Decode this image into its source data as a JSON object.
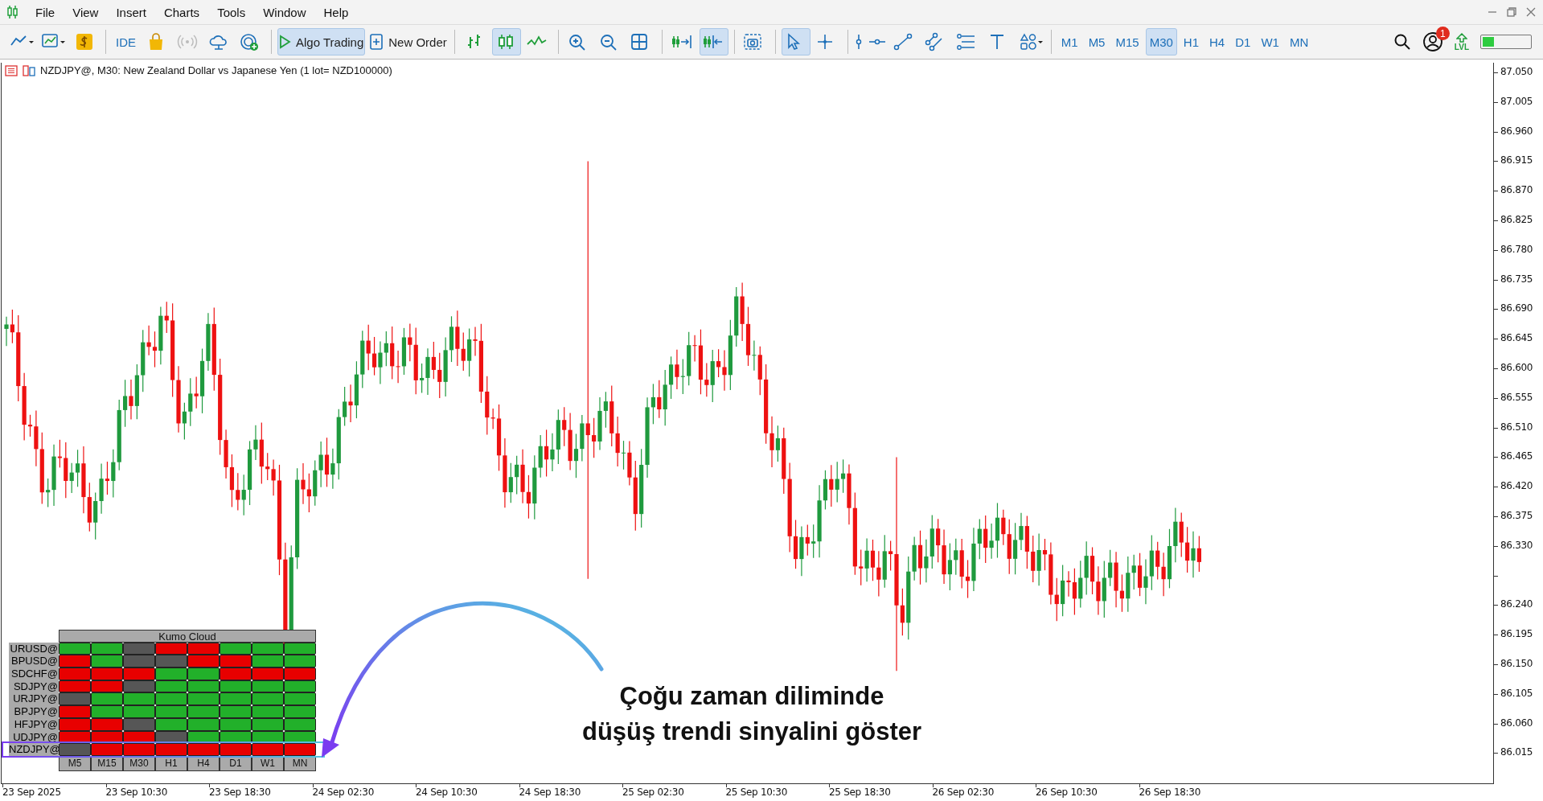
{
  "menu": {
    "items": [
      "File",
      "View",
      "Insert",
      "Charts",
      "Tools",
      "Window",
      "Help"
    ]
  },
  "toolbar": {
    "items": [
      {
        "kind": "line-chart",
        "selected": false
      },
      {
        "kind": "chart-menu",
        "selected": false
      },
      {
        "kind": "dollar",
        "selected": false
      },
      {
        "kind": "sep"
      },
      {
        "kind": "text",
        "label": "IDE",
        "selected": false
      },
      {
        "kind": "bag",
        "selected": false
      },
      {
        "kind": "signal",
        "selected": false
      },
      {
        "kind": "cloud",
        "selected": false
      },
      {
        "kind": "radar",
        "selected": false
      },
      {
        "kind": "sep"
      },
      {
        "kind": "play",
        "label": "Algo Trading",
        "selected": true
      },
      {
        "kind": "order",
        "label": "New Order",
        "selected": false
      },
      {
        "kind": "sep"
      },
      {
        "kind": "bars",
        "selected": false
      },
      {
        "kind": "candles",
        "selected": true
      },
      {
        "kind": "zigzag",
        "selected": false
      },
      {
        "kind": "sep"
      },
      {
        "kind": "zoom-in",
        "selected": false
      },
      {
        "kind": "zoom-out",
        "selected": false
      },
      {
        "kind": "grid",
        "selected": false
      },
      {
        "kind": "sep"
      },
      {
        "kind": "shift",
        "selected": false
      },
      {
        "kind": "autoscroll",
        "selected": true
      },
      {
        "kind": "sep"
      },
      {
        "kind": "screenshot",
        "selected": false
      },
      {
        "kind": "sep"
      },
      {
        "kind": "cursor",
        "selected": true
      },
      {
        "kind": "crosshair",
        "selected": false
      },
      {
        "kind": "sep"
      },
      {
        "kind": "vline",
        "selected": false
      },
      {
        "kind": "hline",
        "selected": false
      },
      {
        "kind": "trendline",
        "selected": false
      },
      {
        "kind": "channel",
        "selected": false
      },
      {
        "kind": "fibo",
        "selected": false
      },
      {
        "kind": "textTool",
        "selected": false
      },
      {
        "kind": "shapes",
        "selected": false
      },
      {
        "kind": "sep"
      },
      {
        "kind": "text",
        "label": "M1",
        "selected": false
      },
      {
        "kind": "text",
        "label": "M5",
        "selected": false
      },
      {
        "kind": "text",
        "label": "M15",
        "selected": false
      },
      {
        "kind": "text",
        "label": "M30",
        "selected": true
      },
      {
        "kind": "text",
        "label": "H1",
        "selected": false
      },
      {
        "kind": "text",
        "label": "H4",
        "selected": false
      },
      {
        "kind": "text",
        "label": "D1",
        "selected": false
      },
      {
        "kind": "text",
        "label": "W1",
        "selected": false
      },
      {
        "kind": "text",
        "label": "MN",
        "selected": false
      }
    ],
    "badge": "1",
    "lvl": "LVL"
  },
  "chart": {
    "title": "NZDJPY@, M30:  New Zealand Dollar vs Japanese Yen (1 lot= NZD100000)",
    "price_labels": [
      "87.050",
      "87.005",
      "86.960",
      "86.915",
      "86.870",
      "86.825",
      "86.780",
      "86.735",
      "86.690",
      "86.645",
      "86.600",
      "86.555",
      "86.510",
      "86.465",
      "86.420",
      "86.375",
      "86.330",
      "86.240",
      "86.195",
      "86.150",
      "86.105",
      "86.060",
      "86.015"
    ],
    "time_labels": [
      "23 Sep 2025",
      "23 Sep 10:30",
      "23 Sep 18:30",
      "24 Sep 02:30",
      "24 Sep 10:30",
      "24 Sep 18:30",
      "25 Sep 02:30",
      "25 Sep 10:30",
      "25 Sep 18:30",
      "26 Sep 02:30",
      "26 Sep 10:30",
      "26 Sep 18:30"
    ]
  },
  "kumo": {
    "title": "Kumo Cloud",
    "rows": [
      {
        "symbol": "URUSD@",
        "cells": [
          {
            "color": "#22b02a"
          },
          {
            "color": "#22b02a"
          },
          {
            "color": "#565656"
          },
          {
            "color": "#e80000"
          },
          {
            "color": "#e80000"
          },
          {
            "color": "#22b02a"
          },
          {
            "color": "#22b02a"
          },
          {
            "color": "#22b02a"
          }
        ]
      },
      {
        "symbol": "BPUSD@",
        "cells": [
          {
            "color": "#e80000"
          },
          {
            "color": "#22b02a"
          },
          {
            "color": "#565656"
          },
          {
            "color": "#565656"
          },
          {
            "color": "#e80000"
          },
          {
            "color": "#e80000"
          },
          {
            "color": "#22b02a"
          },
          {
            "color": "#22b02a"
          }
        ]
      },
      {
        "symbol": "SDCHF@",
        "cells": [
          {
            "color": "#e80000"
          },
          {
            "color": "#e80000"
          },
          {
            "color": "#e80000"
          },
          {
            "color": "#22b02a"
          },
          {
            "color": "#22b02a"
          },
          {
            "color": "#e80000"
          },
          {
            "color": "#e80000"
          },
          {
            "color": "#e80000"
          }
        ]
      },
      {
        "symbol": "SDJPY@",
        "cells": [
          {
            "color": "#e80000"
          },
          {
            "color": "#e80000"
          },
          {
            "color": "#565656"
          },
          {
            "color": "#22b02a"
          },
          {
            "color": "#22b02a"
          },
          {
            "color": "#22b02a"
          },
          {
            "color": "#22b02a"
          },
          {
            "color": "#22b02a"
          }
        ]
      },
      {
        "symbol": "URJPY@",
        "cells": [
          {
            "color": "#565656"
          },
          {
            "color": "#22b02a"
          },
          {
            "color": "#22b02a"
          },
          {
            "color": "#22b02a"
          },
          {
            "color": "#22b02a"
          },
          {
            "color": "#22b02a"
          },
          {
            "color": "#22b02a"
          },
          {
            "color": "#22b02a"
          }
        ]
      },
      {
        "symbol": "BPJPY@",
        "cells": [
          {
            "color": "#e80000"
          },
          {
            "color": "#22b02a"
          },
          {
            "color": "#22b02a"
          },
          {
            "color": "#22b02a"
          },
          {
            "color": "#22b02a"
          },
          {
            "color": "#22b02a"
          },
          {
            "color": "#22b02a"
          },
          {
            "color": "#22b02a"
          }
        ]
      },
      {
        "symbol": "HFJPY@",
        "cells": [
          {
            "color": "#e80000"
          },
          {
            "color": "#e80000"
          },
          {
            "color": "#565656"
          },
          {
            "color": "#22b02a"
          },
          {
            "color": "#22b02a"
          },
          {
            "color": "#22b02a"
          },
          {
            "color": "#22b02a"
          },
          {
            "color": "#22b02a"
          }
        ]
      },
      {
        "symbol": "UDJPY@",
        "cells": [
          {
            "color": "#e80000"
          },
          {
            "color": "#e80000"
          },
          {
            "color": "#e80000"
          },
          {
            "color": "#565656"
          },
          {
            "color": "#22b02a"
          },
          {
            "color": "#22b02a"
          },
          {
            "color": "#22b02a"
          },
          {
            "color": "#22b02a"
          }
        ]
      },
      {
        "symbol": "NZDJPY@",
        "cells": [
          {
            "color": "#565656"
          },
          {
            "color": "#e80000"
          },
          {
            "color": "#e80000"
          },
          {
            "color": "#e80000"
          },
          {
            "color": "#e80000"
          },
          {
            "color": "#e80000"
          },
          {
            "color": "#e80000"
          },
          {
            "color": "#e80000"
          }
        ]
      }
    ],
    "timeframes": [
      "M5",
      "M15",
      "M30",
      "H1",
      "H4",
      "D1",
      "W1",
      "MN"
    ]
  },
  "annotation": {
    "lines": [
      "Çoğu zaman diliminde",
      "düşüş trendi sinyalini göster"
    ]
  }
}
